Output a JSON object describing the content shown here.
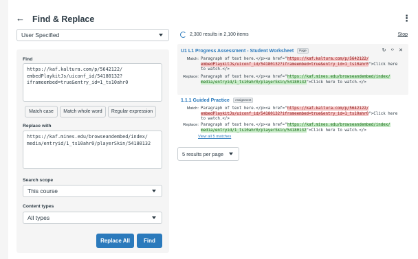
{
  "header": {
    "back_icon": "arrow-left-icon",
    "title": "Find & Replace",
    "menu_icon": "kebab-menu-icon"
  },
  "source_select": {
    "value": "User Specified"
  },
  "find": {
    "label": "Find",
    "value_lines": [
      "https://kaf.kaltura.com/p/5642122/",
      "embedPlaykitJs/uiconf_id/54180132?",
      "iframeembed=true&entry_id=1_ts10ahr0"
    ],
    "buttons": [
      "Match case",
      "Match whole word",
      "Regular expression"
    ]
  },
  "replace": {
    "label": "Replace with",
    "value_lines": [
      "https://kaf.mines.edu/browseandembed/index/",
      "media/entryid/1_ts10ahr0/playerSkin/54180132"
    ]
  },
  "scope": {
    "label": "Search scope",
    "value": "This course"
  },
  "content_types": {
    "label": "Content types",
    "value": "All types"
  },
  "actions": {
    "replace_all": "Replace All",
    "find": "Find"
  },
  "results": {
    "summary": "2,300 results in 2,100 items",
    "stop_label": "Stop",
    "items": [
      {
        "title": "U1 L1 Progress Assessment - Student Worksheet",
        "tag": "Page",
        "match_label": "Match:",
        "match_l1_pre": "Paragraph of text here.</p><a href=\"",
        "match_l1_hl": "https://kaf.kaltura.com/p/5642122/",
        "match_l2_hl": "embedPlaykitJs/uiconf_id/54180132?iframeembed=true&entry_id=1_ts10ahr0",
        "match_l2_post": "\">Click here",
        "match_l3": "to watch.</>",
        "replace_label": "Replace:",
        "replace_l1_pre": "Paragraph of text here.</p><a href=\"",
        "replace_l1_hl": "https://kaf.mines.edu/browseandembed/index/",
        "replace_l2_hl": "media/entryid/1_ts10ahr0/playerSkin/54180132",
        "replace_l2_post": "\">Click here to watch.</>"
      },
      {
        "title": "1.1.1 Guided Practice",
        "tag": "Assignment",
        "match_label": "Match:",
        "match_l1_pre": "Paragraph of text here.</p><a href=\"",
        "match_l1_hl": "https://kaf.kaltura.com/p/5642122/",
        "match_l2_hl": "embedPlaykitJs/uiconf_id/54180132?iframeembed=true&entry_id=1_ts10ahr0",
        "match_l2_post": "\">Click here",
        "match_l3": "to watch.</>",
        "replace_label": "Replace:",
        "replace_l1_pre": "Paragraph of text here.</p><a href=\"",
        "replace_l1_hl": "https://kaf.mines.edu/browseandembed/index/",
        "replace_l2_hl": "media/entryid/1_ts10ahr0/playerSkin/54180132",
        "replace_l2_post": "\">Click here to watch.</>",
        "view_all": "View all 5 matches"
      }
    ],
    "per_page": "5 results per page"
  },
  "colors": {
    "accent": "#2b7abc",
    "match_highlight": "#f7c7c7",
    "replace_highlight": "#c7ebc7"
  }
}
